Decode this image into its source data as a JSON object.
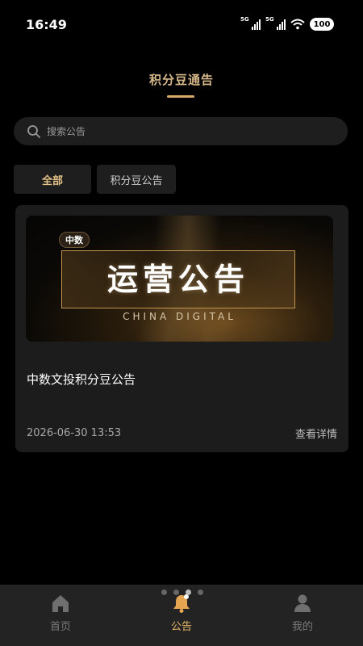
{
  "status_bar": {
    "time": "16:49",
    "signal1_label": "5G",
    "signal2_label": "5G",
    "battery": "100"
  },
  "header": {
    "title": "积分豆通告"
  },
  "search": {
    "placeholder": "搜索公告",
    "value": ""
  },
  "filters": {
    "all_label": "全部",
    "notice_label": "积分豆公告",
    "selected": "全部"
  },
  "card": {
    "banner_chip": "中数",
    "banner_headline": "运营公告",
    "banner_sub": "CHINA DIGITAL",
    "title": "中数文投积分豆公告",
    "date": "2026-06-30 13:53",
    "link_label": "查看详情"
  },
  "tabbar": {
    "items": [
      {
        "label": "首页",
        "icon": "home-icon"
      },
      {
        "label": "公告",
        "icon": "bell-icon"
      },
      {
        "label": "我的",
        "icon": "user-icon"
      }
    ],
    "active": "公告"
  },
  "colors": {
    "accent_gold": "#d6b88a",
    "background": "#000000",
    "card": "#1c1c1c"
  }
}
